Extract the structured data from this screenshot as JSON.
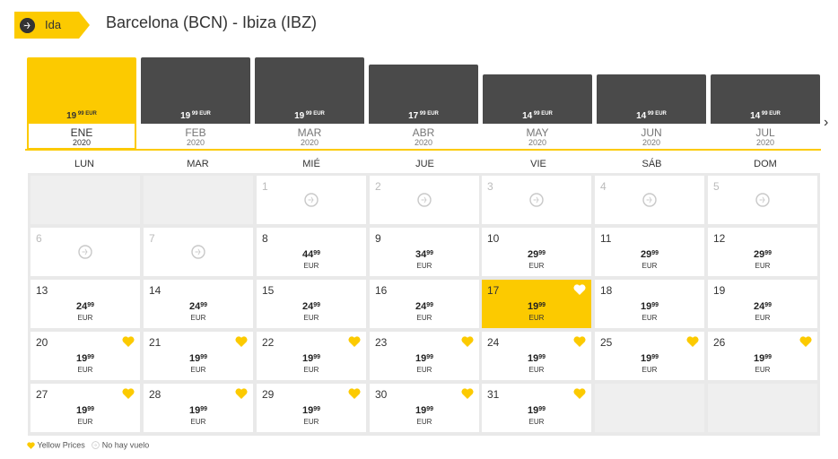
{
  "header": {
    "direction_label": "Ida",
    "route": "Barcelona (BCN) - Ibiza (IBZ)"
  },
  "months": [
    {
      "name": "ENE",
      "year": "2020",
      "price": "19",
      "cents": "99 EUR",
      "selected": true
    },
    {
      "name": "FEB",
      "year": "2020",
      "price": "19",
      "cents": "99 EUR"
    },
    {
      "name": "MAR",
      "year": "2020",
      "price": "19",
      "cents": "99 EUR"
    },
    {
      "name": "ABR",
      "year": "2020",
      "price": "17",
      "cents": "99 EUR"
    },
    {
      "name": "MAY",
      "year": "2020",
      "price": "14",
      "cents": "99 EUR"
    },
    {
      "name": "JUN",
      "year": "2020",
      "price": "14",
      "cents": "99 EUR"
    },
    {
      "name": "JUL",
      "year": "2020",
      "price": "14",
      "cents": "99 EUR"
    }
  ],
  "weekdays": [
    "LUN",
    "MAR",
    "MIÉ",
    "JUE",
    "VIE",
    "SÁB",
    "DOM"
  ],
  "days": [
    {
      "day": "1",
      "noflight": true
    },
    {
      "day": "2",
      "noflight": true
    },
    {
      "day": "3",
      "noflight": true
    },
    {
      "day": "4",
      "noflight": true
    },
    {
      "day": "5",
      "noflight": true
    },
    {
      "day": "6",
      "noflight": true
    },
    {
      "day": "7",
      "noflight": true
    },
    {
      "day": "8",
      "price": "44",
      "cents": "99",
      "currency": "EUR"
    },
    {
      "day": "9",
      "price": "34",
      "cents": "99",
      "currency": "EUR"
    },
    {
      "day": "10",
      "price": "29",
      "cents": "99",
      "currency": "EUR"
    },
    {
      "day": "11",
      "price": "29",
      "cents": "99",
      "currency": "EUR"
    },
    {
      "day": "12",
      "price": "29",
      "cents": "99",
      "currency": "EUR"
    },
    {
      "day": "13",
      "price": "24",
      "cents": "99",
      "currency": "EUR"
    },
    {
      "day": "14",
      "price": "24",
      "cents": "99",
      "currency": "EUR"
    },
    {
      "day": "15",
      "price": "24",
      "cents": "99",
      "currency": "EUR"
    },
    {
      "day": "16",
      "price": "24",
      "cents": "99",
      "currency": "EUR"
    },
    {
      "day": "17",
      "price": "19",
      "cents": "99",
      "currency": "EUR",
      "yellow": true,
      "selected": true
    },
    {
      "day": "18",
      "price": "19",
      "cents": "99",
      "currency": "EUR"
    },
    {
      "day": "19",
      "price": "24",
      "cents": "99",
      "currency": "EUR"
    },
    {
      "day": "20",
      "price": "19",
      "cents": "99",
      "currency": "EUR",
      "yellow": true
    },
    {
      "day": "21",
      "price": "19",
      "cents": "99",
      "currency": "EUR",
      "yellow": true
    },
    {
      "day": "22",
      "price": "19",
      "cents": "99",
      "currency": "EUR",
      "yellow": true
    },
    {
      "day": "23",
      "price": "19",
      "cents": "99",
      "currency": "EUR",
      "yellow": true
    },
    {
      "day": "24",
      "price": "19",
      "cents": "99",
      "currency": "EUR",
      "yellow": true
    },
    {
      "day": "25",
      "price": "19",
      "cents": "99",
      "currency": "EUR",
      "yellow": true
    },
    {
      "day": "26",
      "price": "19",
      "cents": "99",
      "currency": "EUR",
      "yellow": true
    },
    {
      "day": "27",
      "price": "19",
      "cents": "99",
      "currency": "EUR",
      "yellow": true
    },
    {
      "day": "28",
      "price": "19",
      "cents": "99",
      "currency": "EUR",
      "yellow": true
    },
    {
      "day": "29",
      "price": "19",
      "cents": "99",
      "currency": "EUR",
      "yellow": true
    },
    {
      "day": "30",
      "price": "19",
      "cents": "99",
      "currency": "EUR",
      "yellow": true
    },
    {
      "day": "31",
      "price": "19",
      "cents": "99",
      "currency": "EUR",
      "yellow": true
    }
  ],
  "legend": {
    "yellow_prices": "Yellow Prices",
    "no_flight": "No hay vuelo"
  },
  "icons": {
    "plane": "airplane-icon",
    "heart": "heart-icon",
    "next": "chevron-right-icon"
  },
  "colors": {
    "accent": "#fcca00",
    "bar": "#4a4a4a",
    "empty_cell": "#efefef",
    "grid": "#e9e9e9"
  }
}
